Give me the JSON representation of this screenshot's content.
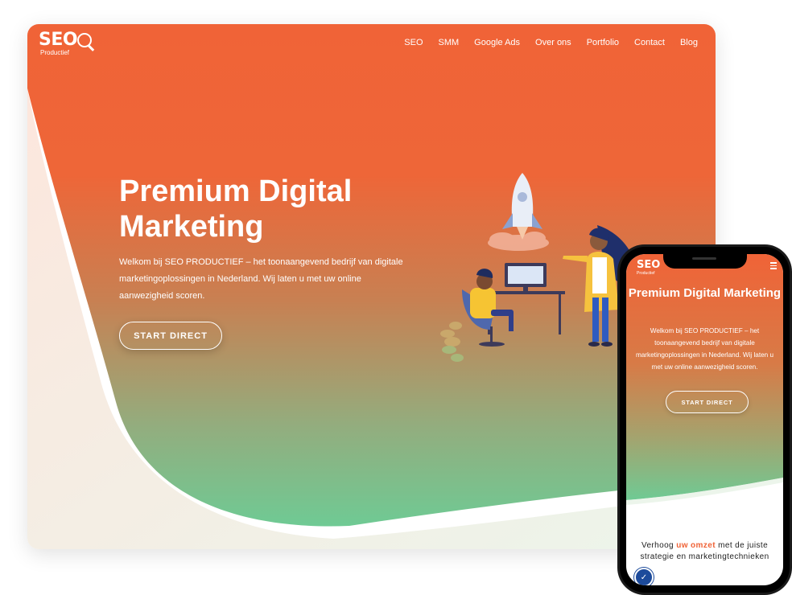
{
  "desktop": {
    "logo": {
      "mark": "SEO",
      "sub": "Productief"
    },
    "nav": [
      {
        "label": "SEO"
      },
      {
        "label": "SMM"
      },
      {
        "label": "Google Ads"
      },
      {
        "label": "Over ons"
      },
      {
        "label": "Portfolio"
      },
      {
        "label": "Contact"
      },
      {
        "label": "Blog"
      }
    ],
    "hero": {
      "title": "Premium Digital Marketing",
      "text": "Welkom bij SEO PRODUCTIEF – het toonaangevend bedrijf van digitale marketingoplossingen in Nederland. Wij laten u met uw online aanwezigheid scoren.",
      "cta": "START DIRECT"
    }
  },
  "mobile": {
    "logo": {
      "mark": "SEO",
      "sub": "Productief"
    },
    "menu_icon": "hamburger-icon",
    "hero": {
      "title": "Premium Digital Marketing",
      "text": "Welkom bij SEO PRODUCTIEF – het toonaangevend bedrijf van digitale marketingoplossingen in Nederland. Wij laten u met uw online aanwezigheid scoren.",
      "cta": "START DIRECT"
    },
    "tagline": {
      "pre": "Verhoog ",
      "accent": "uw omzet",
      "post": " met de juiste strategie en marketingtechnieken"
    },
    "badge_icon": "accessibility-icon"
  },
  "colors": {
    "orange": "#f06337",
    "green": "#72c993",
    "accent_text": "#f06337"
  }
}
